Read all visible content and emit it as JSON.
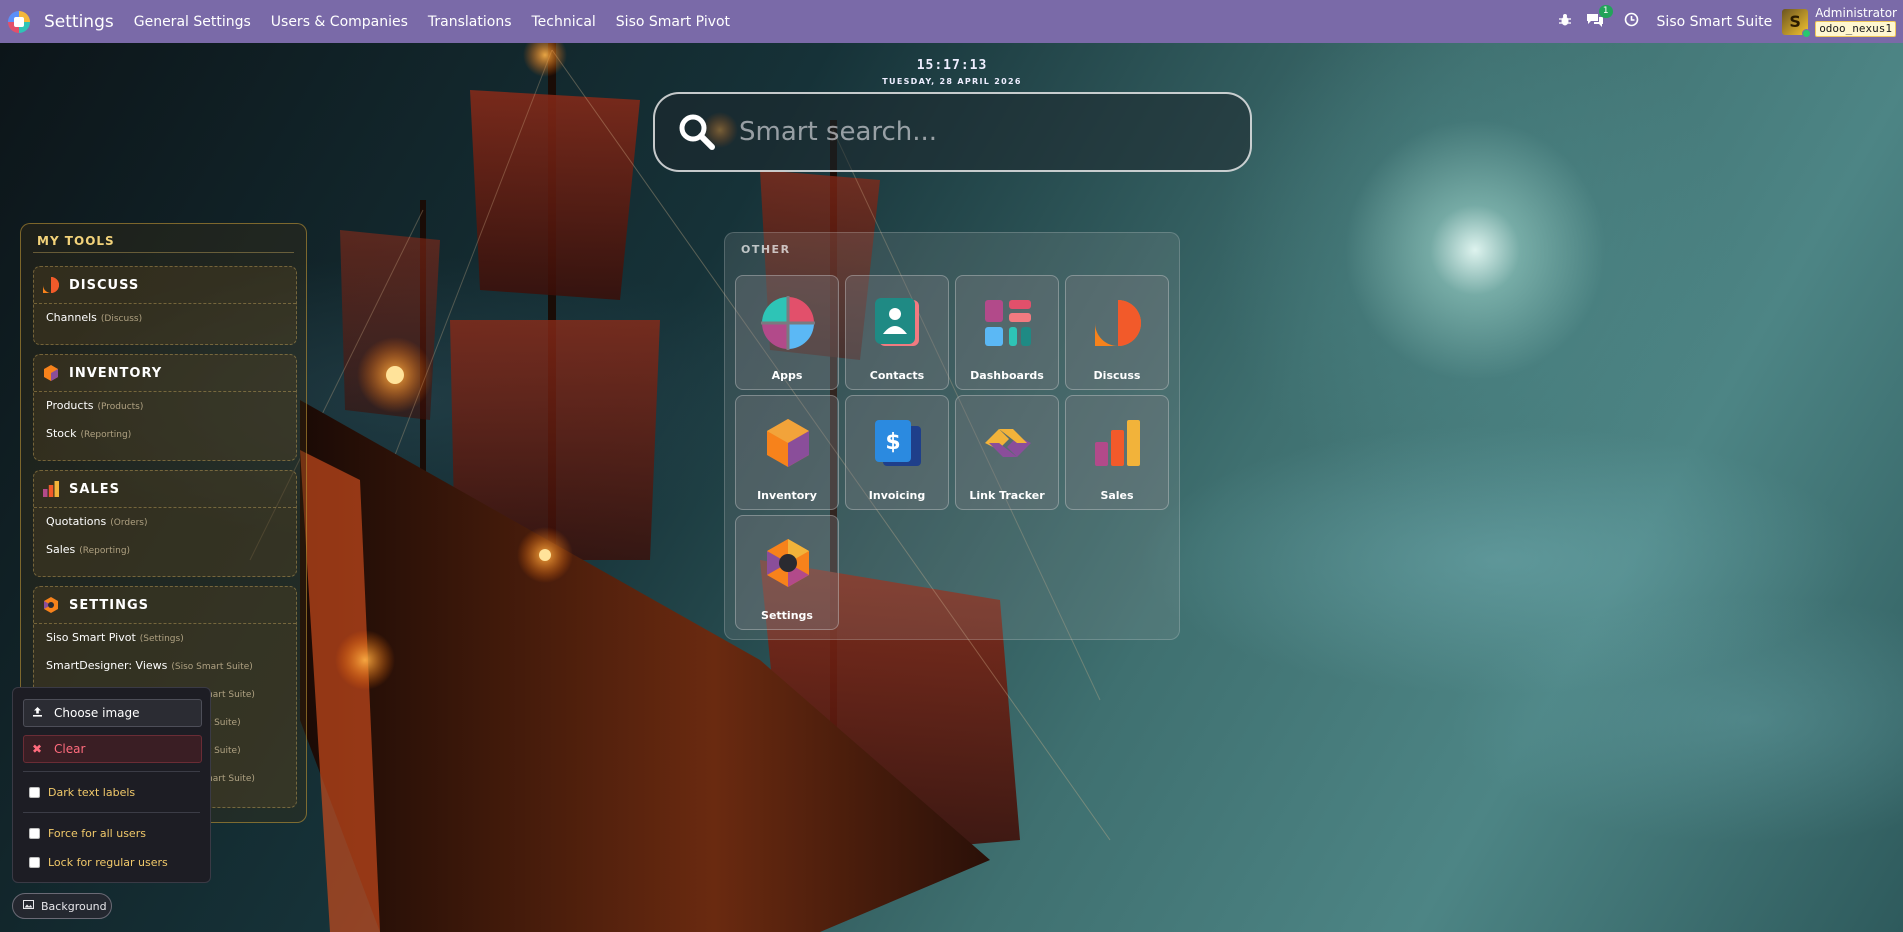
{
  "topbar": {
    "brand": "Settings",
    "nav": [
      "General Settings",
      "Users & Companies",
      "Translations",
      "Technical",
      "Siso Smart Pivot"
    ],
    "chat_badge": "1",
    "suite_name": "Siso Smart Suite",
    "user_name": "Administrator",
    "db_name": "odoo_nexus1"
  },
  "clock": {
    "time": "15:17:13",
    "date": "TUESDAY, 28 APRIL 2026"
  },
  "search": {
    "placeholder": "Smart search..."
  },
  "apps": {
    "title": "OTHER",
    "items": [
      "Apps",
      "Contacts",
      "Dashboards",
      "Discuss",
      "Inventory",
      "Invoicing",
      "Link Tracker",
      "Sales",
      "Settings"
    ]
  },
  "tools": {
    "title": "MY TOOLS",
    "groups": [
      {
        "label": "DISCUSS",
        "links": [
          {
            "label": "Channels",
            "sub": "(Discuss)"
          }
        ]
      },
      {
        "label": "INVENTORY",
        "links": [
          {
            "label": "Products",
            "sub": "(Products)"
          },
          {
            "label": "Stock",
            "sub": "(Reporting)"
          }
        ]
      },
      {
        "label": "SALES",
        "links": [
          {
            "label": "Quotations",
            "sub": "(Orders)"
          },
          {
            "label": "Sales",
            "sub": "(Reporting)"
          }
        ]
      },
      {
        "label": "SETTINGS",
        "links": [
          {
            "label": "Siso Smart Pivot",
            "sub": "(Settings)"
          },
          {
            "label": "SmartDesigner: Views",
            "sub": "(Siso Smart Suite)"
          },
          {
            "label": "",
            "sub": "mart Suite)"
          },
          {
            "label": "",
            "sub": "rt Suite)"
          },
          {
            "label": "",
            "sub": "rt Suite)"
          },
          {
            "label": "",
            "sub": "mart Suite)"
          }
        ]
      }
    ]
  },
  "background_popover": {
    "choose_label": "Choose image",
    "clear_label": "Clear",
    "dark_labels": "Dark text labels",
    "force_all": "Force for all users",
    "lock_regular": "Lock for regular users"
  },
  "background_button": "Background",
  "colors": {
    "topbar": "#7a6aa8",
    "accent_gold": "#f2d27a",
    "clear_red": "#ff6b7d"
  }
}
